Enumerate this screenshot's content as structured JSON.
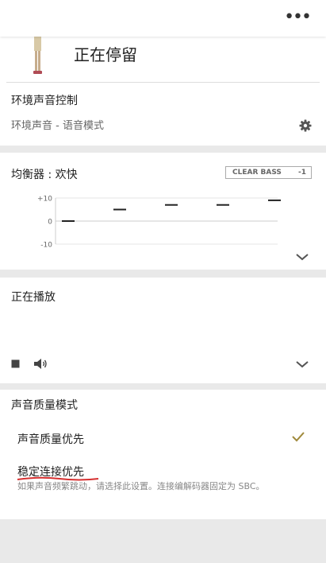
{
  "top_bar": {
    "menu_icon": "more-horizontal-icon",
    "menu_glyph": "•••"
  },
  "status": {
    "title": "正在停留",
    "icon": "standing-person-icon"
  },
  "ambient": {
    "title": "环境声音控制",
    "value": "环境声音 - 语音模式",
    "settings_icon": "gear-icon"
  },
  "equalizer": {
    "title": "均衡器 : 欢快",
    "clear_bass_label": "CLEAR BASS",
    "clear_bass_value": "-1",
    "expand_icon": "chevron-down-icon",
    "chart_data": {
      "type": "line",
      "ticks": [
        "+10",
        "0",
        "-10"
      ],
      "ylim": [
        -10,
        10
      ],
      "bands": 5,
      "values": [
        0,
        5,
        7,
        7,
        9
      ],
      "colors": {
        "marker": "#222222",
        "axis": "#cccccc",
        "grid": "#e5e5e5",
        "tick": "#666666"
      }
    }
  },
  "now_playing": {
    "title": "正在播放",
    "stop_icon": "stop-icon",
    "volume_icon": "volume-icon",
    "expand_icon": "chevron-down-icon"
  },
  "sound_quality": {
    "title": "声音质量模式",
    "options": [
      {
        "label": "声音质量优先",
        "selected": true
      },
      {
        "label": "稳定连接优先",
        "selected": false
      }
    ],
    "description": "如果声音频繁跳动，请选择此设置。连接编解码器固定为 SBC。",
    "check_color": "#a08a3c",
    "annotation_color": "#d63030"
  }
}
